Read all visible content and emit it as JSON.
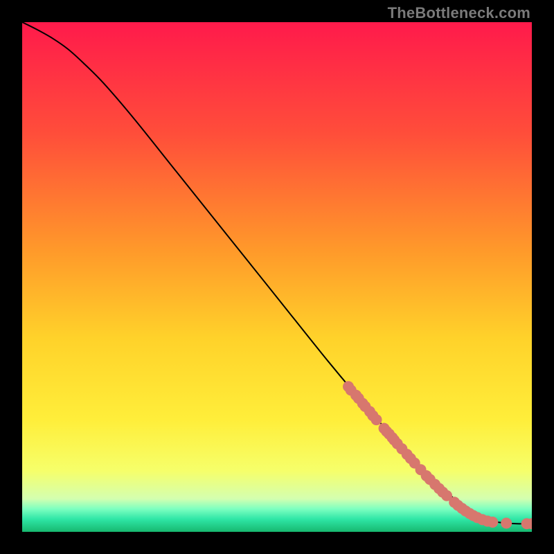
{
  "watermark": "TheBottleneck.com",
  "chart_data": {
    "type": "line",
    "title": "",
    "xlabel": "",
    "ylabel": "",
    "xlim": [
      0,
      100
    ],
    "ylim": [
      0,
      100
    ],
    "grid": false,
    "legend": false,
    "background_gradient": {
      "stops": [
        {
          "offset": 0.0,
          "color": "#ff1a4b"
        },
        {
          "offset": 0.22,
          "color": "#ff4e3a"
        },
        {
          "offset": 0.45,
          "color": "#ff9a2a"
        },
        {
          "offset": 0.62,
          "color": "#ffd22a"
        },
        {
          "offset": 0.78,
          "color": "#ffee3a"
        },
        {
          "offset": 0.88,
          "color": "#f6ff6a"
        },
        {
          "offset": 0.935,
          "color": "#d4ffb0"
        },
        {
          "offset": 0.955,
          "color": "#7dffc0"
        },
        {
          "offset": 0.975,
          "color": "#2fe6a6"
        },
        {
          "offset": 1.0,
          "color": "#17b86f"
        }
      ]
    },
    "series": [
      {
        "name": "curve",
        "type": "line",
        "stroke": "#000000",
        "stroke_width": 2,
        "points": [
          {
            "x": 0.0,
            "y": 100.0
          },
          {
            "x": 3.0,
            "y": 98.5
          },
          {
            "x": 6.0,
            "y": 96.8
          },
          {
            "x": 9.0,
            "y": 94.7
          },
          {
            "x": 12.0,
            "y": 92.0
          },
          {
            "x": 16.0,
            "y": 88.0
          },
          {
            "x": 22.0,
            "y": 81.0
          },
          {
            "x": 30.0,
            "y": 71.0
          },
          {
            "x": 40.0,
            "y": 58.5
          },
          {
            "x": 50.0,
            "y": 46.0
          },
          {
            "x": 60.0,
            "y": 33.5
          },
          {
            "x": 68.0,
            "y": 24.0
          },
          {
            "x": 76.0,
            "y": 15.0
          },
          {
            "x": 82.0,
            "y": 9.0
          },
          {
            "x": 86.0,
            "y": 5.5
          },
          {
            "x": 89.0,
            "y": 3.5
          },
          {
            "x": 91.5,
            "y": 2.3
          },
          {
            "x": 94.0,
            "y": 1.8
          },
          {
            "x": 97.0,
            "y": 1.6
          },
          {
            "x": 100.0,
            "y": 1.6
          }
        ]
      },
      {
        "name": "markers",
        "type": "scatter",
        "color": "#d7776e",
        "radius": 8,
        "points": [
          {
            "x": 64.0,
            "y": 28.5
          },
          {
            "x": 64.5,
            "y": 27.8
          },
          {
            "x": 65.5,
            "y": 26.8
          },
          {
            "x": 66.0,
            "y": 26.2
          },
          {
            "x": 66.8,
            "y": 25.2
          },
          {
            "x": 67.3,
            "y": 24.6
          },
          {
            "x": 68.2,
            "y": 23.6
          },
          {
            "x": 68.8,
            "y": 22.8
          },
          {
            "x": 69.5,
            "y": 22.0
          },
          {
            "x": 71.0,
            "y": 20.3
          },
          {
            "x": 71.5,
            "y": 19.7
          },
          {
            "x": 72.0,
            "y": 19.2
          },
          {
            "x": 72.6,
            "y": 18.5
          },
          {
            "x": 73.0,
            "y": 18.0
          },
          {
            "x": 73.6,
            "y": 17.3
          },
          {
            "x": 74.5,
            "y": 16.3
          },
          {
            "x": 75.5,
            "y": 15.2
          },
          {
            "x": 76.2,
            "y": 14.4
          },
          {
            "x": 77.0,
            "y": 13.5
          },
          {
            "x": 78.2,
            "y": 12.2
          },
          {
            "x": 79.3,
            "y": 11.0
          },
          {
            "x": 80.0,
            "y": 10.3
          },
          {
            "x": 81.0,
            "y": 9.3
          },
          {
            "x": 81.8,
            "y": 8.5
          },
          {
            "x": 82.5,
            "y": 7.8
          },
          {
            "x": 83.3,
            "y": 7.1
          },
          {
            "x": 84.8,
            "y": 5.8
          },
          {
            "x": 85.5,
            "y": 5.2
          },
          {
            "x": 86.3,
            "y": 4.6
          },
          {
            "x": 87.0,
            "y": 4.1
          },
          {
            "x": 87.8,
            "y": 3.6
          },
          {
            "x": 88.5,
            "y": 3.2
          },
          {
            "x": 89.3,
            "y": 2.8
          },
          {
            "x": 90.3,
            "y": 2.4
          },
          {
            "x": 91.3,
            "y": 2.1
          },
          {
            "x": 92.3,
            "y": 1.9
          },
          {
            "x": 95.0,
            "y": 1.7
          },
          {
            "x": 99.0,
            "y": 1.6
          },
          {
            "x": 100.0,
            "y": 1.6
          }
        ]
      }
    ]
  }
}
